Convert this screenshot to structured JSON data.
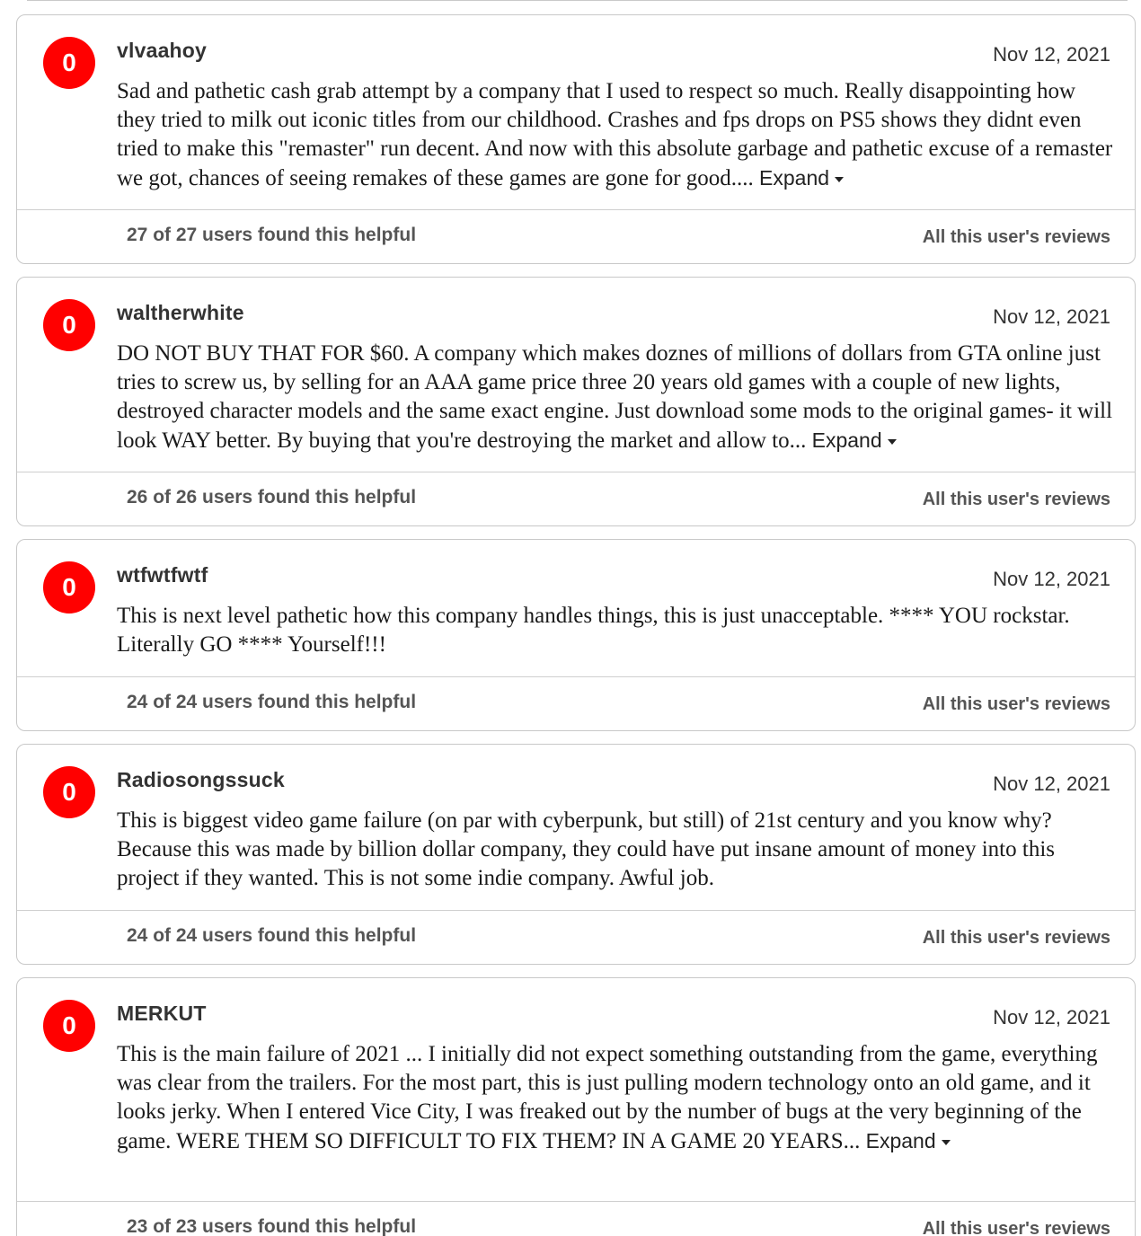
{
  "reviews": [
    {
      "score": "0",
      "author": "vlvaahoy",
      "date": "Nov 12, 2021",
      "text": "Sad and pathetic cash grab attempt by a company that I used to respect so much. Really disappointing how they tried to milk out iconic titles from our childhood. Crashes and fps drops on PS5 shows they didnt even tried to make this \"remaster\" run decent. And now with this absolute garbage and pathetic excuse of a remaster we got, chances of seeing remakes of these games are gone for good....",
      "expand_label": "Expand",
      "helpful": "27 of 27 users found this helpful",
      "all_reviews_label": "All this user's reviews"
    },
    {
      "score": "0",
      "author": "waltherwhite",
      "date": "Nov 12, 2021",
      "text": "DO NOT BUY THAT FOR $60. A company which makes doznes of millions of dollars from GTA online just tries to screw us, by selling for an AAA game price three 20 years old games with a couple of new lights, destroyed character models and the same exact engine. Just download some mods to the original games- it will look WAY better. By buying that you're destroying the market and allow to...",
      "expand_label": "Expand",
      "helpful": "26 of 26 users found this helpful",
      "all_reviews_label": "All this user's reviews"
    },
    {
      "score": "0",
      "author": "wtfwtfwtf",
      "date": "Nov 12, 2021",
      "text": "This is next level pathetic how this company handles things, this is just unacceptable. **** YOU rockstar. Literally GO **** Yourself!!!",
      "expand_label": "",
      "helpful": "24 of 24 users found this helpful",
      "all_reviews_label": "All this user's reviews"
    },
    {
      "score": "0",
      "author": "Radiosongssuck",
      "date": "Nov 12, 2021",
      "text": "This is biggest video game failure (on par with cyberpunk, but still) of 21st century and you know why? Because this was made by billion dollar company, they could have put insane amount of money into this project if they wanted. This is not some indie company. Awful job.",
      "expand_label": "",
      "helpful": "24 of 24 users found this helpful",
      "all_reviews_label": "All this user's reviews"
    },
    {
      "score": "0",
      "author": "MERKUT",
      "date": "Nov 12, 2021",
      "text": "This is the main failure of 2021 ... I initially did not expect something outstanding from the game, everything was clear from the trailers. For the most part, this is just pulling modern technology onto an old game, and it looks jerky. When I entered Vice City, I was freaked out by the number of bugs at the very beginning of the game. WERE THEM SO DIFFICULT TO FIX THEM? IN A GAME 20 YEARS...",
      "expand_label": "Expand",
      "helpful": "23 of 23 users found this helpful",
      "all_reviews_label": "All this user's reviews"
    }
  ],
  "colors": {
    "score_negative": "#ff0000",
    "card_border": "#c8c8c8",
    "helpful_text": "#555555"
  }
}
